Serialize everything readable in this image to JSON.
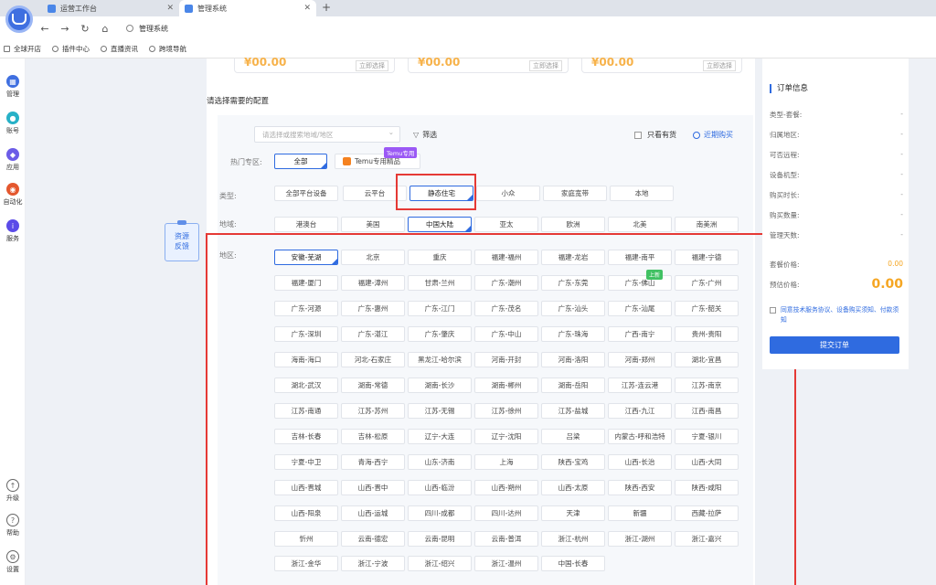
{
  "browser": {
    "tabs": [
      {
        "label": "运营工作台"
      },
      {
        "label": "管理系统"
      }
    ],
    "url": "管理系统",
    "bookmarks": [
      "全球开店",
      "插件中心",
      "直播资讯",
      "跨境导航"
    ]
  },
  "rail": {
    "items": [
      {
        "label": "管理"
      },
      {
        "label": "账号"
      },
      {
        "label": "应用"
      },
      {
        "label": "自动化"
      },
      {
        "label": "服务"
      }
    ],
    "bottom": [
      {
        "label": "升级"
      },
      {
        "label": "帮助"
      },
      {
        "label": "设置"
      }
    ]
  },
  "feedback": {
    "line1": "资源",
    "line2": "反馈"
  },
  "top_cards": {
    "price": "¥00.00",
    "buy": "立即选择"
  },
  "section_title": "请选择需要的配置",
  "config": {
    "search_placeholder": "请选择或搜索地域/地区",
    "filter_label": "筛选",
    "stock_label": "只看有货",
    "recent_label": "近期购买",
    "hot_label": "热门专区:",
    "hot_all": "全部",
    "temu_label": "Temu专用精品",
    "temu_tag": "Temu专用",
    "type_label": "类型:",
    "types": [
      "全部平台设备",
      "云平台",
      "静态住宅",
      "小众",
      "家庭宽带",
      "本地"
    ],
    "area_label": "地域:",
    "areas": [
      "港澳台",
      "美国",
      "中国大陆",
      "亚太",
      "欧洲",
      "北美",
      "南美洲"
    ],
    "region_label": "地区:",
    "new_badge": "上新",
    "regions": [
      "安徽-芜湖",
      "北京",
      "重庆",
      "福建-福州",
      "福建-龙岩",
      "福建-南平",
      "福建-宁德",
      "福建-厦门",
      "福建-漳州",
      "甘肃-兰州",
      "广东-潮州",
      "广东-东莞",
      "广东-佛山",
      "广东-广州",
      "广东-河源",
      "广东-惠州",
      "广东-江门",
      "广东-茂名",
      "广东-汕头",
      "广东-汕尾",
      "广东-韶关",
      "广东-深圳",
      "广东-湛江",
      "广东-肇庆",
      "广东-中山",
      "广东-珠海",
      "广西-南宁",
      "贵州-贵阳",
      "海南-海口",
      "河北-石家庄",
      "黑龙江-哈尔滨",
      "河南-开封",
      "河南-洛阳",
      "河南-郑州",
      "湖北-宜昌",
      "湖北-武汉",
      "湖南-常德",
      "湖南-长沙",
      "湖南-郴州",
      "湖南-岳阳",
      "江苏-连云港",
      "江苏-南京",
      "江苏-南通",
      "江苏-苏州",
      "江苏-无锡",
      "江苏-徐州",
      "江苏-盐城",
      "江西-九江",
      "江西-南昌",
      "吉林-长春",
      "吉林-松原",
      "辽宁-大连",
      "辽宁-沈阳",
      "吕梁",
      "内蒙古-呼和浩特",
      "宁夏-银川",
      "宁夏-中卫",
      "青海-西宁",
      "山东-济南",
      "上海",
      "陕西-宝鸡",
      "山西-长治",
      "山西-大同",
      "山西-晋城",
      "山西-晋中",
      "山西-临汾",
      "山西-朔州",
      "山西-太原",
      "陕西-西安",
      "陕西-咸阳",
      "山西-阳泉",
      "山西-运城",
      "四川-成都",
      "四川-达州",
      "天津",
      "新疆",
      "西藏-拉萨",
      "忻州",
      "云南-德宏",
      "云南-昆明",
      "云南-普洱",
      "浙江-杭州",
      "浙江-湖州",
      "浙江-嘉兴",
      "浙江-金华",
      "浙江-宁波",
      "浙江-绍兴",
      "浙江-温州",
      "中国-长春"
    ]
  },
  "order": {
    "title": "订单信息",
    "rows": [
      {
        "label": "类型-套餐:",
        "value": "-"
      },
      {
        "label": "归属地区:",
        "value": "-"
      },
      {
        "label": "可否远程:",
        "value": "-"
      },
      {
        "label": "设备机型:",
        "value": "-"
      },
      {
        "label": "购买时长:",
        "value": "-"
      },
      {
        "label": "购买数量:",
        "value": "-"
      },
      {
        "label": "管理天数:",
        "value": "-"
      }
    ],
    "package_price_label": "套餐价格:",
    "package_price": "0.00",
    "estimate_label": "预估价格:",
    "estimate": "0.00",
    "agree_text": "同意技术服务协议、设备购买须知、付款须知",
    "submit": "提交订单"
  },
  "colors": {
    "accent": "#2f6be0",
    "highlight": "#e53935",
    "price": "#f5a623"
  }
}
